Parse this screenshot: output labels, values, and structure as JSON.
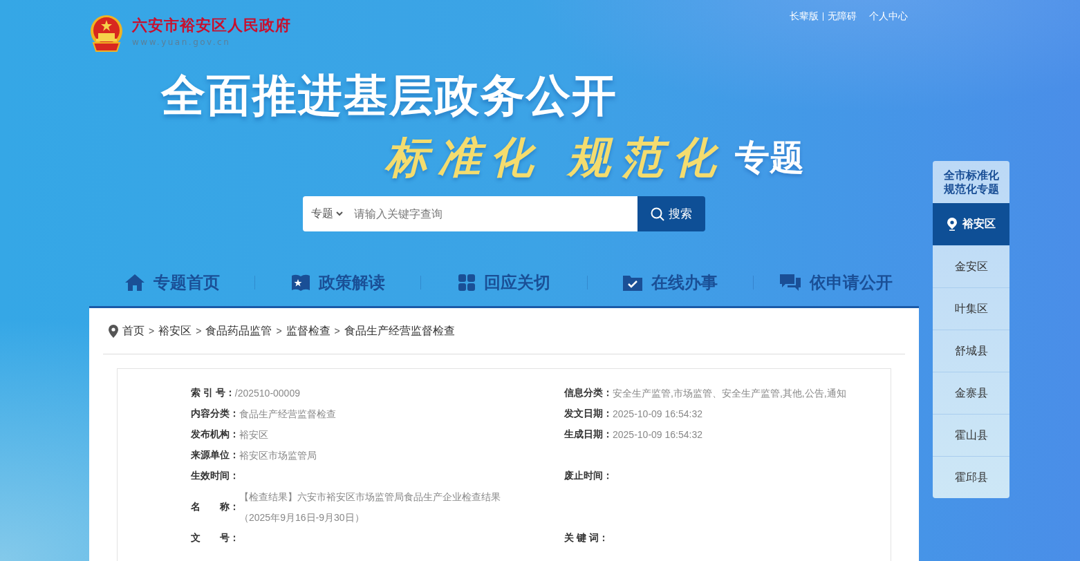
{
  "site": {
    "name": "六安市裕安区人民政府",
    "url": "www.yuan.gov.cn"
  },
  "top_links": [
    {
      "label": "长辈版"
    },
    {
      "label": "无障碍"
    },
    {
      "label": "个人中心"
    }
  ],
  "banner": {
    "title": "全面推进基层政务公开",
    "slogan": "标准化 规范化",
    "slogan_suffix": "专题"
  },
  "search": {
    "scope": "专题",
    "placeholder": "请输入关键字查询",
    "button": "搜索"
  },
  "nav": [
    {
      "label": "专题首页"
    },
    {
      "label": "政策解读"
    },
    {
      "label": "回应关切"
    },
    {
      "label": "在线办事"
    },
    {
      "label": "依申请公开"
    }
  ],
  "breadcrumb": {
    "separator": ">",
    "items": [
      "首页",
      "裕安区",
      "食品药品监管",
      "监督检查",
      "食品生产经营监督检查"
    ]
  },
  "info": [
    {
      "left": {
        "label": "索 引 号：",
        "value": [
          "/202510-00009"
        ]
      },
      "right": {
        "label": "信息分类：",
        "value": [
          "安全生产监管,市场监管、安全生产监管,其他,公告,通知"
        ]
      }
    },
    {
      "left": {
        "label": "内容分类：",
        "value": [
          "食品生产经营监督检查"
        ]
      },
      "right": {
        "label": "发文日期：",
        "value": [
          "2025-10-09 16:54:32"
        ]
      }
    },
    {
      "left": {
        "label": "发布机构：",
        "value": [
          "裕安区"
        ]
      },
      "right": {
        "label": "生成日期：",
        "value": [
          "2025-10-09 16:54:32"
        ]
      }
    },
    {
      "left": {
        "label": "来源单位：",
        "value": [
          "裕安区市场监管局"
        ]
      }
    },
    {
      "left": {
        "label": "生效时间："
      },
      "right": {
        "label": "废止时间："
      }
    },
    {
      "left": {
        "label": "名　　称：",
        "value": [
          "【检查结果】六安市裕安区市场监管局食品生产企业检查结果",
          "（2025年9月16日-9月30日）"
        ]
      }
    },
    {
      "left": {
        "label": "文　　号："
      },
      "right": {
        "label": "关 键 词："
      }
    }
  ],
  "side_panel": {
    "title": "全市标准化规范化专题",
    "items": [
      {
        "label": "裕安区",
        "selected": true
      },
      {
        "label": "金安区",
        "selected": false
      },
      {
        "label": "叶集区",
        "selected": false
      },
      {
        "label": "舒城县",
        "selected": false
      },
      {
        "label": "金寨县",
        "selected": false
      },
      {
        "label": "霍山县",
        "selected": false
      },
      {
        "label": "霍邱县",
        "selected": false
      }
    ]
  }
}
